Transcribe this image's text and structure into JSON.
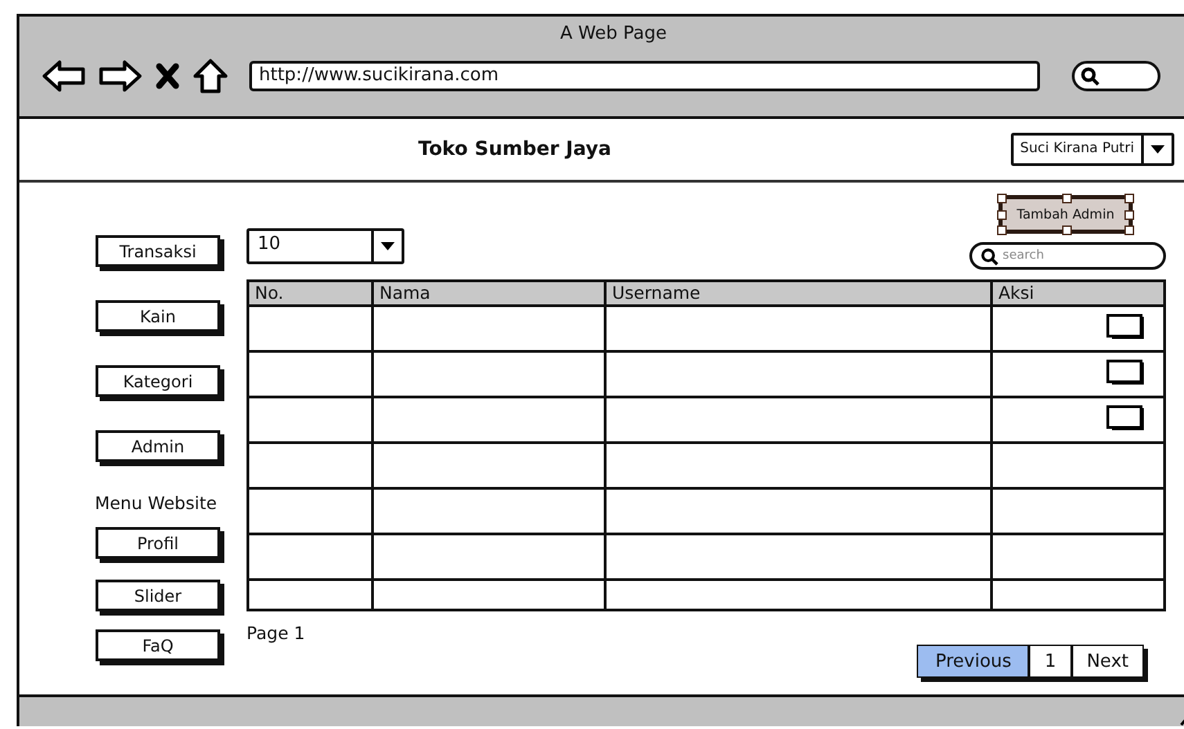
{
  "window": {
    "title": "A Web Page",
    "url": "http://www.sucikirana.com"
  },
  "header": {
    "title": "Toko Sumber Jaya",
    "user": "Suci Kirana Putri"
  },
  "sidebar": {
    "items": [
      {
        "kind": "button",
        "label": "Transaksi"
      },
      {
        "kind": "button",
        "label": "Kain"
      },
      {
        "kind": "button",
        "label": "Kategori"
      },
      {
        "kind": "button",
        "label": "Admin"
      },
      {
        "kind": "label",
        "label": "Menu Website"
      },
      {
        "kind": "button",
        "label": "Profil"
      },
      {
        "kind": "button",
        "label": "Slider"
      },
      {
        "kind": "button",
        "label": "FaQ"
      }
    ]
  },
  "page_size": "10",
  "add_button": {
    "label": "Tambah Admin",
    "selected": true
  },
  "search": {
    "placeholder": "search"
  },
  "table": {
    "columns": [
      "No.",
      "Nama",
      "Username",
      "Aksi"
    ],
    "rows": [
      {
        "action": true
      },
      {
        "action": true
      },
      {
        "action": true
      },
      {
        "action": false
      },
      {
        "action": false
      },
      {
        "action": false
      },
      {
        "action": false
      }
    ]
  },
  "page_label": "Page 1",
  "pagination": [
    {
      "label": "Previous",
      "selected": true
    },
    {
      "label": "1",
      "selected": false
    },
    {
      "label": "Next",
      "selected": false
    }
  ]
}
